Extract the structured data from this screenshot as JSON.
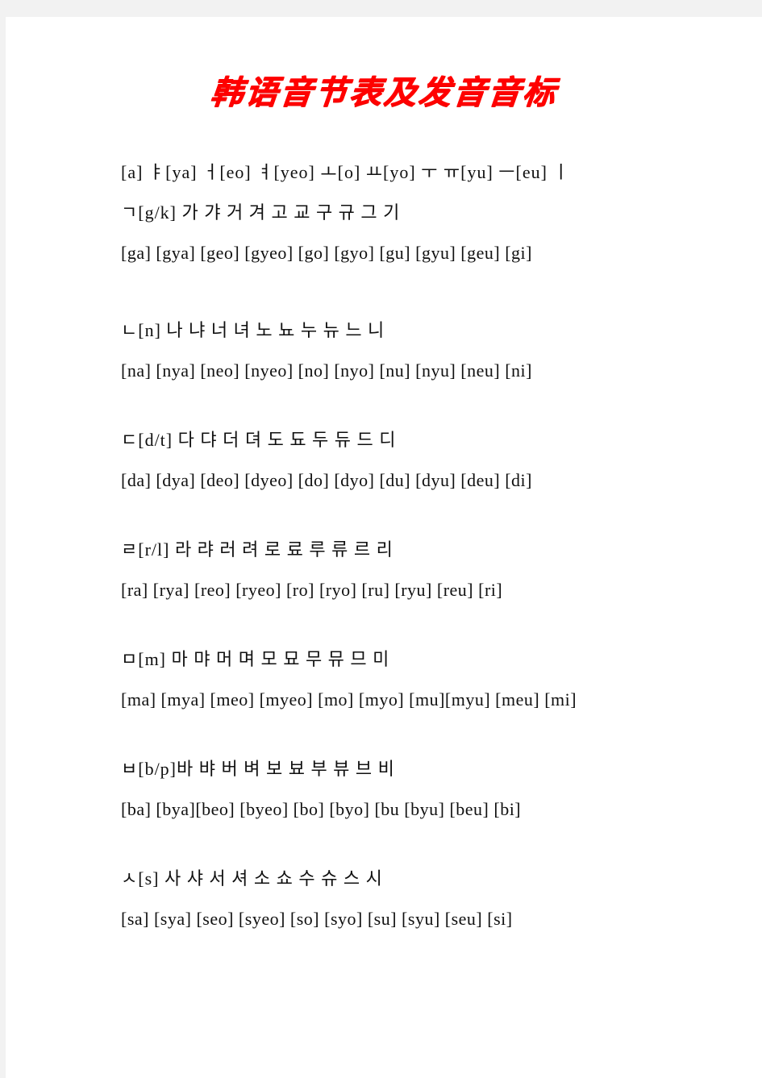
{
  "document": {
    "title": "韩语音节表及发音音标",
    "title_color": "#ff0000",
    "page_background": "#ffffff",
    "canvas_background": "#f2f2f2",
    "text_color": "#101010"
  },
  "vowel_line": "[a] ㅑ[ya] ㅓ[eo] ㅕ[yeo] ㅗ[o] ㅛ[yo] ㅜ ㅠ[yu] ㅡ[eu] ㅣ",
  "rows": [
    {
      "consonant": "ㄱ",
      "consonant_sound": "[g/k]",
      "hangul_line": "ㄱ[g/k] 가 갸 거 겨 고 교 구 규 그 기",
      "roman_line": "[ga] [gya] [geo] [gyeo] [go] [gyo] [gu] [gyu] [geu] [gi]",
      "syllables": [
        "가",
        "갸",
        "거",
        "겨",
        "고",
        "교",
        "구",
        "규",
        "그",
        "기"
      ],
      "romanizations": [
        "[ga]",
        "[gya]",
        "[geo]",
        "[gyeo]",
        "[go]",
        "[gyo]",
        "[gu]",
        "[gyu]",
        "[geu]",
        "[gi]"
      ]
    },
    {
      "consonant": "ㄴ",
      "consonant_sound": "[n]",
      "hangul_line": "ㄴ[n] 나 냐 너 녀 노 뇨 누 뉴 느 니",
      "roman_line": "[na] [nya] [neo] [nyeo] [no] [nyo] [nu] [nyu] [neu] [ni]",
      "syllables": [
        "나",
        "냐",
        "너",
        "녀",
        "노",
        "뇨",
        "누",
        "뉴",
        "느",
        "니"
      ],
      "romanizations": [
        "[na]",
        "[nya]",
        "[neo]",
        "[nyeo]",
        "[no]",
        "[nyo]",
        "[nu]",
        "[nyu]",
        "[neu]",
        "[ni]"
      ]
    },
    {
      "consonant": "ㄷ",
      "consonant_sound": "[d/t]",
      "hangul_line": "ㄷ[d/t] 다 댜 더 뎌 도 됴 두 듀 드 디",
      "roman_line": "[da] [dya] [deo] [dyeo] [do] [dyo] [du] [dyu] [deu] [di]",
      "syllables": [
        "다",
        "댜",
        "더",
        "뎌",
        "도",
        "됴",
        "두",
        "듀",
        "드",
        "디"
      ],
      "romanizations": [
        "[da]",
        "[dya]",
        "[deo]",
        "[dyeo]",
        "[do]",
        "[dyo]",
        "[du]",
        "[dyu]",
        "[deu]",
        "[di]"
      ]
    },
    {
      "consonant": "ㄹ",
      "consonant_sound": "[r/l]",
      "hangul_line": "ㄹ[r/l] 라 랴 러 려 로 료 루 류 르 리",
      "roman_line": "[ra] [rya] [reo] [ryeo] [ro] [ryo] [ru] [ryu] [reu] [ri]",
      "syllables": [
        "라",
        "랴",
        "러",
        "려",
        "로",
        "료",
        "루",
        "류",
        "르",
        "리"
      ],
      "romanizations": [
        "[ra]",
        "[rya]",
        "[reo]",
        "[ryeo]",
        "[ro]",
        "[ryo]",
        "[ru]",
        "[ryu]",
        "[reu]",
        "[ri]"
      ]
    },
    {
      "consonant": "ㅁ",
      "consonant_sound": "[m]",
      "hangul_line": "ㅁ[m] 마 먀 머 며 모 묘 무 뮤 므 미",
      "roman_line": "[ma] [mya] [meo] [myeo] [mo] [myo] [mu][myu] [meu] [mi]",
      "syllables": [
        "마",
        "먀",
        "머",
        "며",
        "모",
        "묘",
        "무",
        "뮤",
        "므",
        "미"
      ],
      "romanizations": [
        "[ma]",
        "[mya]",
        "[meo]",
        "[myeo]",
        "[mo]",
        "[myo]",
        "[mu]",
        "[myu]",
        "[meu]",
        "[mi]"
      ]
    },
    {
      "consonant": "ㅂ",
      "consonant_sound": "[b/p]",
      "hangul_line": "ㅂ[b/p]바 뱌 버 벼 보 뵤 부 뷰 브 비",
      "roman_line": "[ba] [bya][beo] [byeo] [bo] [byo] [bu [byu] [beu] [bi]",
      "syllables": [
        "바",
        "뱌",
        "버",
        "벼",
        "보",
        "뵤",
        "부",
        "뷰",
        "브",
        "비"
      ],
      "romanizations": [
        "[ba]",
        "[bya]",
        "[beo]",
        "[byeo]",
        "[bo]",
        "[byo]",
        "[bu",
        "[byu]",
        "[beu]",
        "[bi]"
      ]
    },
    {
      "consonant": "ㅅ",
      "consonant_sound": "[s]",
      "hangul_line": "ㅅ[s] 사 샤 서 셔 소 쇼 수 슈 스 시",
      "roman_line": "[sa] [sya] [seo] [syeo] [so] [syo] [su] [syu] [seu] [si]",
      "syllables": [
        "사",
        "샤",
        "서",
        "셔",
        "소",
        "쇼",
        "수",
        "슈",
        "스",
        "시"
      ],
      "romanizations": [
        "[sa]",
        "[sya]",
        "[seo]",
        "[syeo]",
        "[so]",
        "[syo]",
        "[su]",
        "[syu]",
        "[seu]",
        "[si]"
      ]
    }
  ]
}
